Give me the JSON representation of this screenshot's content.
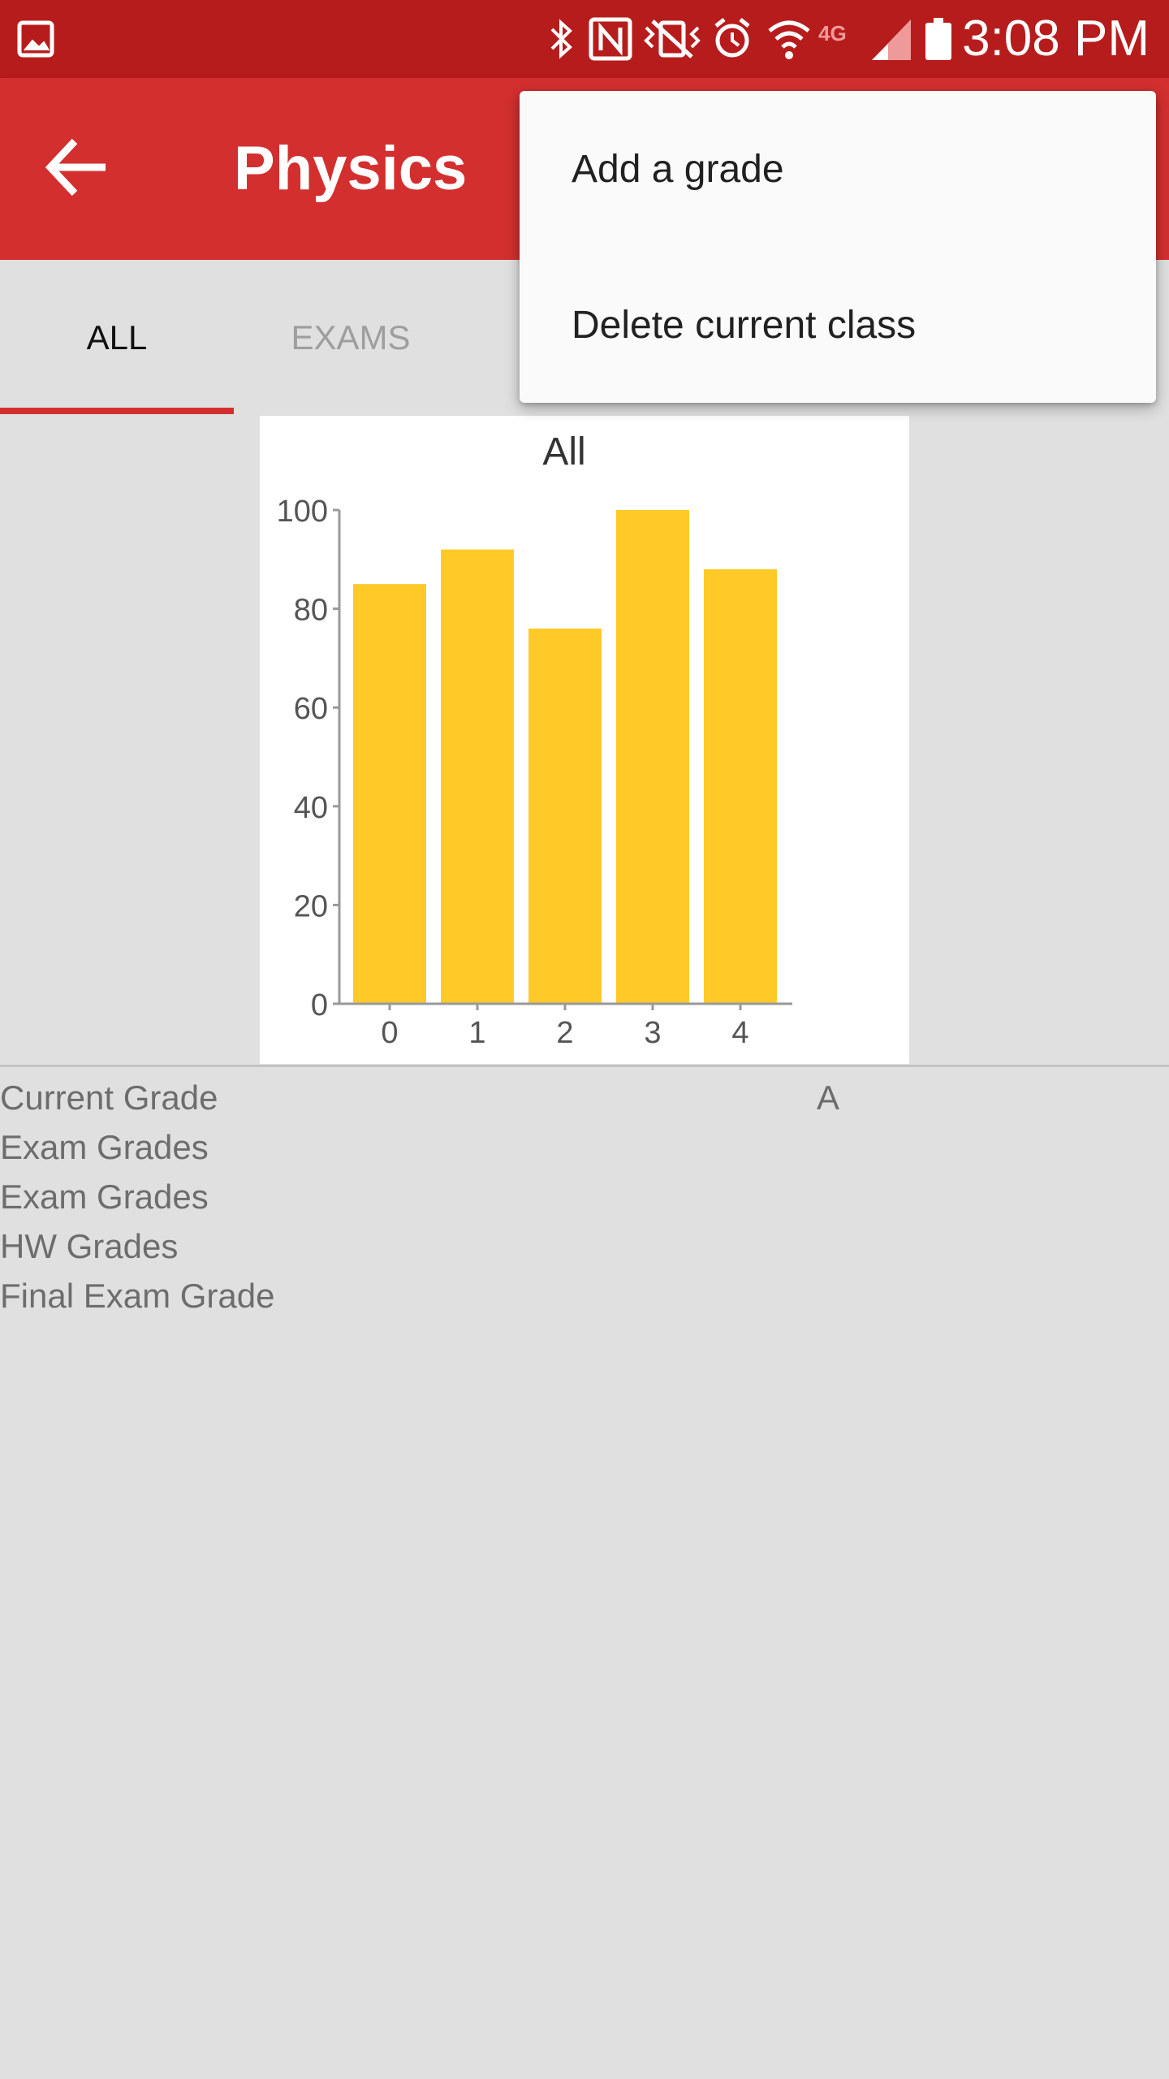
{
  "status_bar": {
    "time": "3:08 PM",
    "icons": [
      "gallery-icon",
      "bluetooth-icon",
      "nfc-icon",
      "vibrate-icon",
      "alarm-icon",
      "wifi-icon",
      "4g-icon",
      "signal-icon",
      "battery-icon"
    ],
    "network_label": "4G"
  },
  "app_bar": {
    "title": "Physics",
    "back_icon": "arrow-left-icon"
  },
  "tabs": [
    {
      "label": "ALL",
      "active": true
    },
    {
      "label": "EXAMS",
      "active": false
    }
  ],
  "overflow_menu": {
    "items": [
      {
        "label": "Add a grade"
      },
      {
        "label": "Delete current class"
      }
    ]
  },
  "chart_data": {
    "type": "bar",
    "title": "All",
    "categories": [
      "0",
      "1",
      "2",
      "3",
      "4"
    ],
    "values": [
      85,
      92,
      76,
      100,
      88
    ],
    "ylim": [
      0,
      100
    ],
    "yticks": [
      "0",
      "20",
      "40",
      "60",
      "80",
      "100"
    ],
    "xlabel": "",
    "ylabel": "",
    "bar_color": "#ffca28",
    "grid": false
  },
  "grades": {
    "rows": [
      {
        "label": "Current Grade",
        "value": "A"
      },
      {
        "label": "Exam Grades",
        "value": ""
      },
      {
        "label": "Exam Grades",
        "value": ""
      },
      {
        "label": "HW Grades",
        "value": ""
      },
      {
        "label": "Final Exam Grade",
        "value": ""
      }
    ]
  },
  "colors": {
    "status_bar": "#b71c1c",
    "app_bar": "#d32f2f",
    "accent": "#d32f2f",
    "background": "#e0e0e0",
    "menu_background": "#fafafa"
  }
}
